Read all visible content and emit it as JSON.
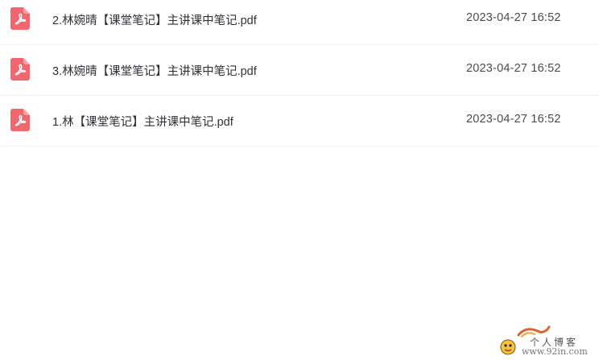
{
  "files": [
    {
      "name": "2.林婉晴【课堂笔记】主讲课中笔记.pdf",
      "date": "2023-04-27 16:52",
      "icon": "pdf-icon"
    },
    {
      "name": "3.林婉晴【课堂笔记】主讲课中笔记.pdf",
      "date": "2023-04-27 16:52",
      "icon": "pdf-icon"
    },
    {
      "name": "1.林【课堂笔记】主讲课中笔记.pdf",
      "date": "2023-04-27 16:52",
      "icon": "pdf-icon"
    }
  ],
  "watermark": {
    "title": "个人博客",
    "url": "www.92in.com"
  },
  "colors": {
    "pdf_icon": "#f0676f",
    "divider": "#f0f1f3",
    "text": "#2f3338"
  }
}
